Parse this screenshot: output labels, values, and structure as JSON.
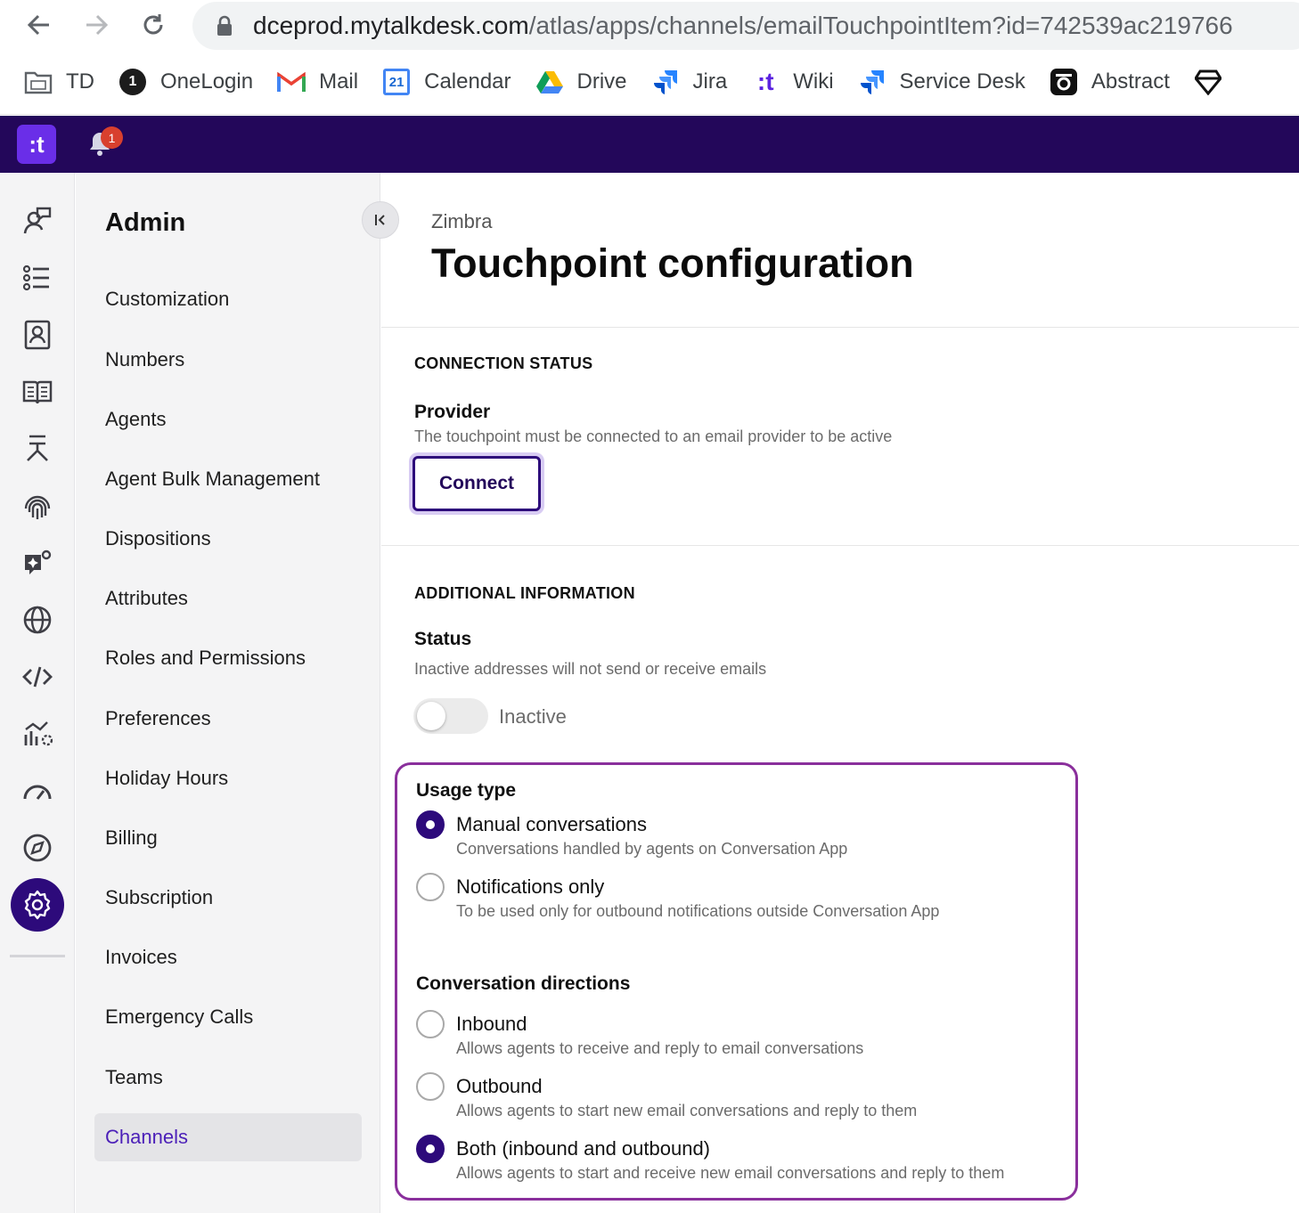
{
  "browser": {
    "url_host": "dceprod.mytalkdesk.com",
    "url_path": "/atlas/apps/channels/emailTouchpointItem?id=742539ac219766",
    "bookmarks": [
      {
        "label": "TD",
        "icon": "folder-icon"
      },
      {
        "label": "OneLogin",
        "icon": "onelogin-icon"
      },
      {
        "label": "Mail",
        "icon": "gmail-icon"
      },
      {
        "label": "Calendar",
        "icon": "calendar-icon"
      },
      {
        "label": "Drive",
        "icon": "drive-icon"
      },
      {
        "label": "Jira",
        "icon": "jira-icon"
      },
      {
        "label": "Wiki",
        "icon": "talkdesk-icon"
      },
      {
        "label": "Service Desk",
        "icon": "jira-icon"
      },
      {
        "label": "Abstract",
        "icon": "abstract-icon"
      }
    ],
    "calendar_day": "21",
    "onelogin_glyph": "1"
  },
  "header": {
    "logo_text": ":t",
    "notification_count": "1",
    "bg_color": "#23075a"
  },
  "admin_nav": {
    "title": "Admin",
    "items": [
      "Customization",
      "Numbers",
      "Agents",
      "Agent Bulk Management",
      "Dispositions",
      "Attributes",
      "Roles and Permissions",
      "Preferences",
      "Holiday Hours",
      "Billing",
      "Subscription",
      "Invoices",
      "Emergency Calls",
      "Teams",
      "Channels"
    ],
    "active": "Channels"
  },
  "main": {
    "breadcrumb": "Zimbra",
    "title": "Touchpoint configuration",
    "connection": {
      "section_title": "CONNECTION STATUS",
      "provider_label": "Provider",
      "provider_help": "The touchpoint must be connected to an email provider to be active",
      "connect_label": "Connect"
    },
    "additional": {
      "section_title": "ADDITIONAL INFORMATION",
      "status_label": "Status",
      "status_help": "Inactive addresses will not send or receive emails",
      "toggle_label": "Inactive",
      "toggle_on": false
    },
    "usage": {
      "heading": "Usage type",
      "options": [
        {
          "label": "Manual conversations",
          "help": "Conversations handled by agents on Conversation App",
          "checked": true
        },
        {
          "label": "Notifications only",
          "help": "To be used only for outbound notifications outside Conversation App",
          "checked": false
        }
      ]
    },
    "directions": {
      "heading": "Conversation directions",
      "options": [
        {
          "label": "Inbound",
          "help": "Allows agents to receive and reply to email conversations",
          "checked": false
        },
        {
          "label": "Outbound",
          "help": "Allows agents to start new email conversations and reply to them",
          "checked": false
        },
        {
          "label": "Both (inbound and outbound)",
          "help": "Allows agents to start and receive new email conversations and reply to them",
          "checked": true
        }
      ]
    }
  },
  "colors": {
    "accent": "#2d0a7b",
    "highlight_border": "#8a2f9c",
    "active_nav_text": "#4b1fb8"
  }
}
